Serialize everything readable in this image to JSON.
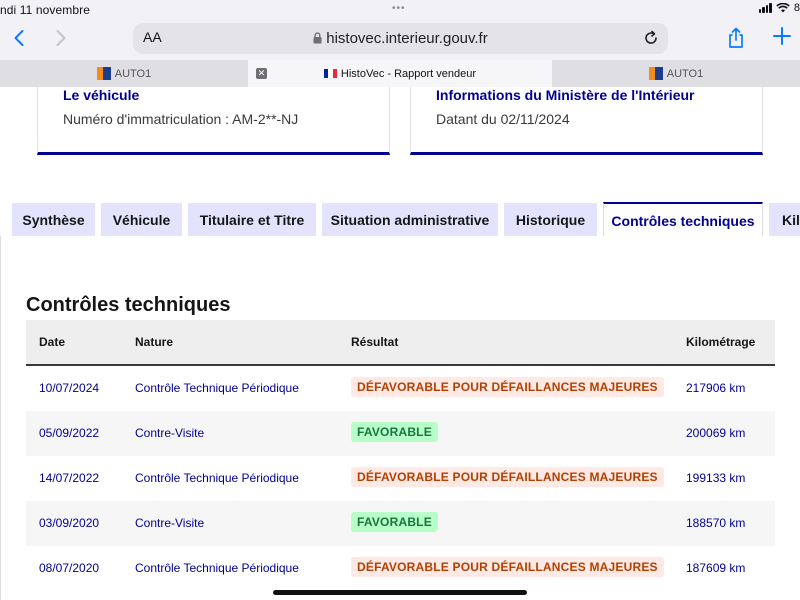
{
  "status": {
    "date": "ndi 11 novembre",
    "battery": "8"
  },
  "browser": {
    "aa_label": "AA",
    "url": "histovec.interieur.gouv.fr",
    "tabs": [
      {
        "label": "AUTO1"
      },
      {
        "label": "HistoVec - Rapport vendeur"
      },
      {
        "label": "AUTO1"
      }
    ]
  },
  "cards": {
    "vehicle": {
      "title": "Le véhicule",
      "text": "Numéro d'immatriculation : AM-2**-NJ"
    },
    "ministry": {
      "title": "Informations du Ministère de l'Intérieur",
      "text": "Datant du 02/11/2024"
    }
  },
  "section_tabs": [
    {
      "label": "Synthèse"
    },
    {
      "label": "Véhicule"
    },
    {
      "label": "Titulaire et Titre"
    },
    {
      "label": "Situation administrative"
    },
    {
      "label": "Historique"
    },
    {
      "label": "Contrôles techniques",
      "active": true
    },
    {
      "label": "Kil"
    }
  ],
  "controles": {
    "title": "Contrôles techniques",
    "columns": {
      "date": "Date",
      "nature": "Nature",
      "result": "Résultat",
      "km": "Kilométrage"
    },
    "rows": [
      {
        "date": "10/07/2024",
        "nature": "Contrôle Technique Périodique",
        "result": "DÉFAVORABLE POUR DÉFAILLANCES MAJEURES",
        "status": "bad",
        "km": "217906 km"
      },
      {
        "date": "05/09/2022",
        "nature": "Contre-Visite",
        "result": "FAVORABLE",
        "status": "good",
        "km": "200069 km"
      },
      {
        "date": "14/07/2022",
        "nature": "Contrôle Technique Périodique",
        "result": "DÉFAVORABLE POUR DÉFAILLANCES MAJEURES",
        "status": "bad",
        "km": "199133 km"
      },
      {
        "date": "03/09/2020",
        "nature": "Contre-Visite",
        "result": "FAVORABLE",
        "status": "good",
        "km": "188570 km"
      },
      {
        "date": "08/07/2020",
        "nature": "Contrôle Technique Périodique",
        "result": "DÉFAVORABLE POUR DÉFAILLANCES MAJEURES",
        "status": "bad",
        "km": "187609 km"
      }
    ]
  },
  "colors": {
    "accent": "#000091",
    "bad_bg": "#fee9e5",
    "bad_text": "#b34000",
    "good_bg": "#b8fec9",
    "good_text": "#18753c"
  }
}
